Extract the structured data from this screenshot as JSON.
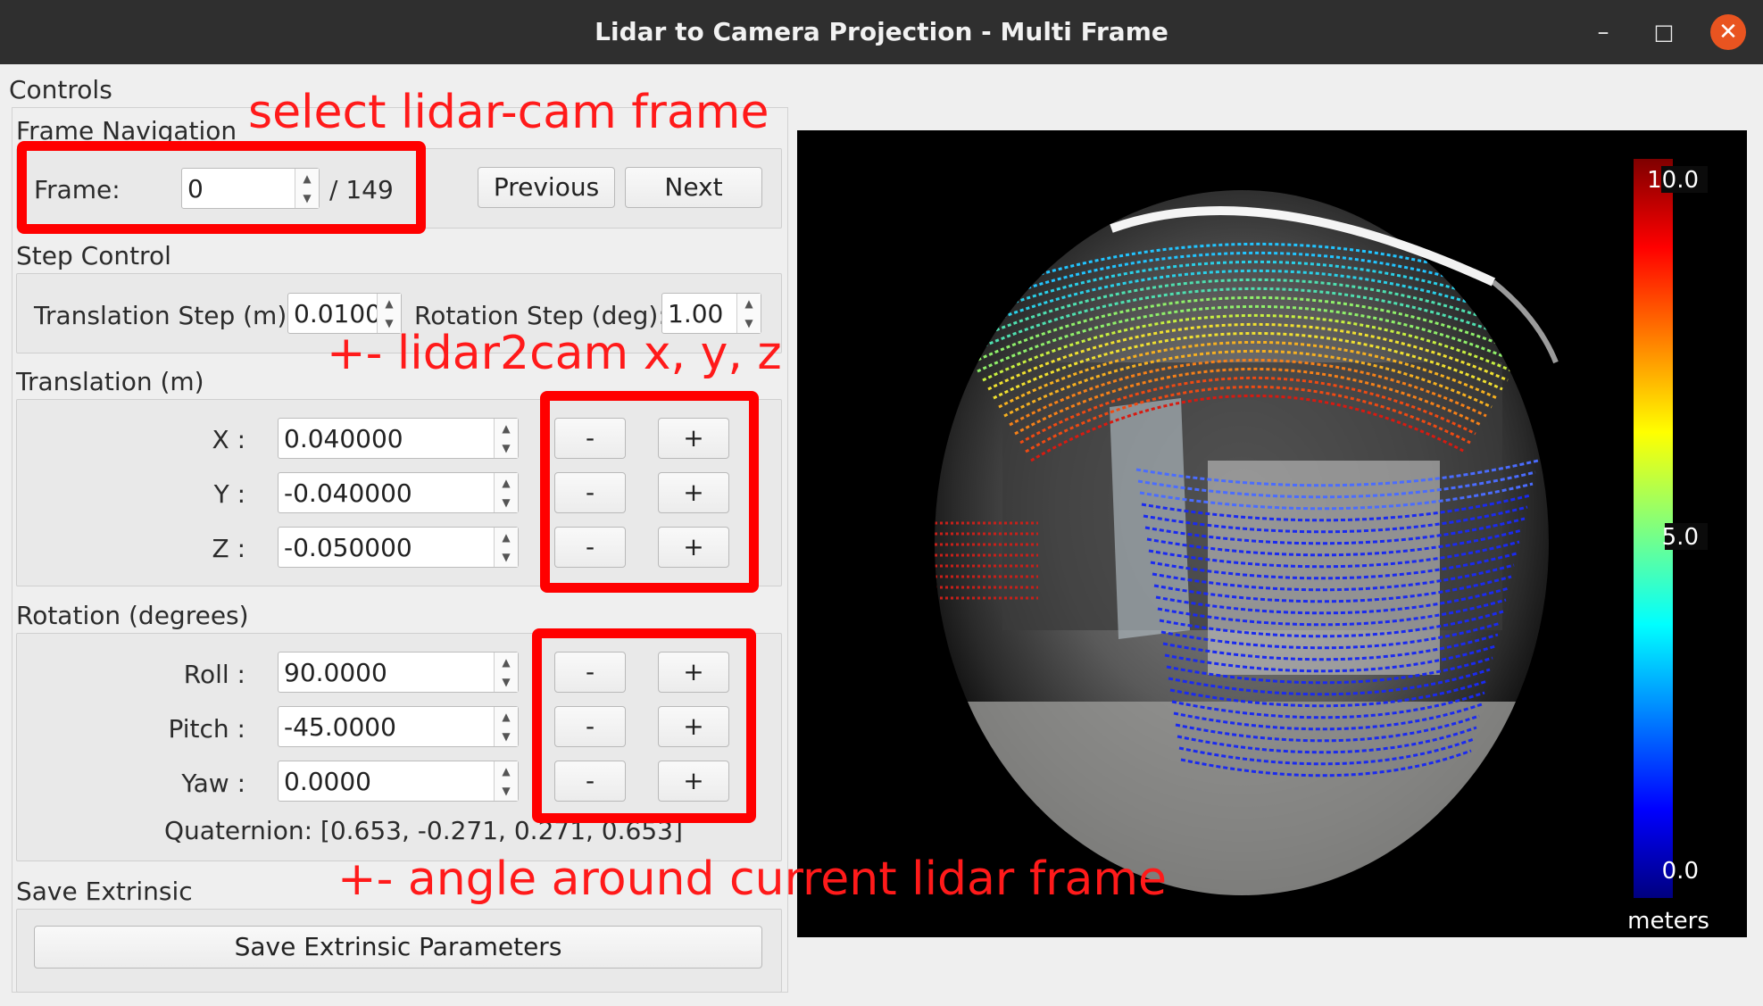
{
  "window": {
    "title": "Lidar to Camera Projection - Multi Frame",
    "minimize": "–",
    "maximize": "□",
    "close": "✕"
  },
  "controls_title": "Controls",
  "frame_nav": {
    "title": "Frame Navigation",
    "frame_label": "Frame:",
    "frame_value": "0",
    "frame_total": "/ 149",
    "prev": "Previous",
    "next": "Next"
  },
  "step": {
    "title": "Step Control",
    "trans_label": "Translation Step (m):",
    "trans_value": "0.0100",
    "rot_label": "Rotation Step (deg):",
    "rot_value": "1.00"
  },
  "translation": {
    "title": "Translation (m)",
    "rows": [
      {
        "label": "X :",
        "value": "0.040000",
        "minus": "-",
        "plus": "+"
      },
      {
        "label": "Y :",
        "value": "-0.040000",
        "minus": "-",
        "plus": "+"
      },
      {
        "label": "Z :",
        "value": "-0.050000",
        "minus": "-",
        "plus": "+"
      }
    ]
  },
  "rotation": {
    "title": "Rotation (degrees)",
    "rows": [
      {
        "label": "Roll :",
        "value": "90.0000",
        "minus": "-",
        "plus": "+"
      },
      {
        "label": "Pitch :",
        "value": "-45.0000",
        "minus": "-",
        "plus": "+"
      },
      {
        "label": "Yaw :",
        "value": "0.0000",
        "minus": "-",
        "plus": "+"
      }
    ],
    "quaternion": "Quaternion: [0.653, -0.271, 0.271, 0.653]"
  },
  "save": {
    "title": "Save Extrinsic",
    "button": "Save Extrinsic Parameters"
  },
  "annotations": {
    "frame": "select lidar-cam frame",
    "translation": "+- lidar2cam x, y, z",
    "rotation": "+- angle around current lidar frame"
  },
  "colorbar": {
    "max": "10.0",
    "mid": "5.0",
    "min": "0.0",
    "unit": "meters"
  },
  "colors": {
    "titlebar": "#2f2f2f",
    "close": "#e95420",
    "annotation": "#ff0000"
  }
}
